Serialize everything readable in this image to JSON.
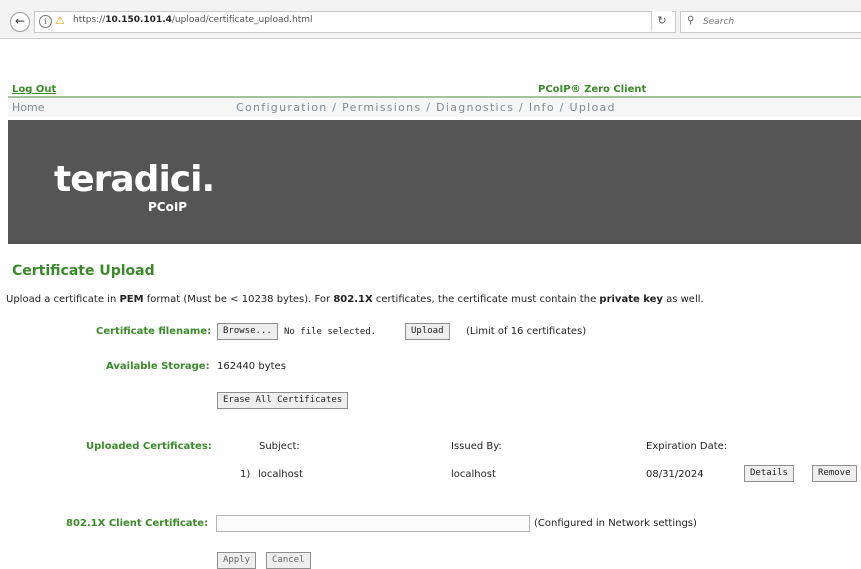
{
  "browser": {
    "url_prefix": "https://",
    "url_host": "10.150.101.4",
    "url_path": "/upload/certificate_upload.html",
    "search_placeholder": "Search"
  },
  "header": {
    "logout": "Log Out",
    "product": "PCoIP® Zero Client"
  },
  "nav": {
    "home": "Home",
    "configuration": "Configuration",
    "permissions": "Permissions",
    "diagnostics": "Diagnostics",
    "info": "Info",
    "upload": "Upload",
    "separator": " / "
  },
  "banner": {
    "logo_main": "teradici.",
    "logo_sub": "PCoIP"
  },
  "page": {
    "title": "Certificate Upload",
    "intro": {
      "p1": "Upload a certificate in ",
      "b1": "PEM",
      "p2": " format (Must be < 10238 bytes). For ",
      "b2": "802.1X",
      "p3": " certificates, the certificate must contain the ",
      "b3": "private key",
      "p4": " as well."
    },
    "cert_filename_label": "Certificate filename:",
    "browse_label": "Browse...",
    "no_file": "No file selected.",
    "upload_label": "Upload",
    "limit_note": "(Limit of 16 certificates)",
    "storage_label": "Available Storage:",
    "storage_value": "162440 bytes",
    "erase_label": "Erase All Certificates",
    "uploaded_label": "Uploaded Certificates:",
    "columns": {
      "subject": "Subject:",
      "issued_by": "Issued By:",
      "expiration": "Expiration Date:"
    },
    "certs": [
      {
        "index": "1)",
        "subject": "localhost",
        "issued_by": "localhost",
        "expiration": "08/31/2024",
        "details_label": "Details",
        "remove_label": "Remove"
      }
    ],
    "client_cert_label": "802.1X Client Certificate:",
    "client_cert_value": "",
    "client_cert_note": "(Configured in Network settings)",
    "apply_label": "Apply",
    "cancel_label": "Cancel"
  }
}
